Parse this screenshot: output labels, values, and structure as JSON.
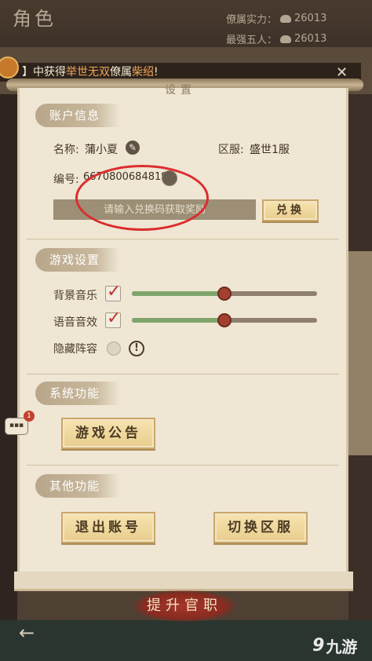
{
  "header": {
    "title": "角色",
    "stats": [
      {
        "label": "僚属实力：",
        "value": "26013"
      },
      {
        "label": "最强五人：",
        "value": "26013"
      }
    ]
  },
  "notice": {
    "prefix": "】中获得",
    "highlight1": "举世无双",
    "middle": "僚属",
    "highlight2": "柴绍",
    "suffix": "!"
  },
  "panel": {
    "title": "设置",
    "account": {
      "section_label": "账户信息",
      "name_label": "名称:",
      "name_value": "蒲小夏",
      "server_label": "区服:",
      "server_value": "盛世1服",
      "id_label": "编号:",
      "id_value": "6670800684819",
      "redeem_placeholder": "请输入兑换码获取奖励",
      "redeem_button": "兑换"
    },
    "game_settings": {
      "section_label": "游戏设置",
      "bgm_label": "背景音乐",
      "bgm_checked": true,
      "bgm_level": 0.5,
      "voice_label": "语音音效",
      "voice_checked": true,
      "voice_level": 0.5,
      "hide_lineup_label": "隐藏阵容",
      "hide_lineup_on": false
    },
    "system": {
      "section_label": "系统功能",
      "announcement_button": "游戏公告"
    },
    "other": {
      "section_label": "其他功能",
      "logout_button": "退出账号",
      "switch_server_button": "切换区服"
    }
  },
  "bottom": {
    "promote_button": "提升官职",
    "chat_badge": "1",
    "watermark": "九游"
  },
  "colors": {
    "annotation": "#dc2d2d",
    "slider_fill": "#7fa56d",
    "slider_knob": "#a3402f"
  }
}
